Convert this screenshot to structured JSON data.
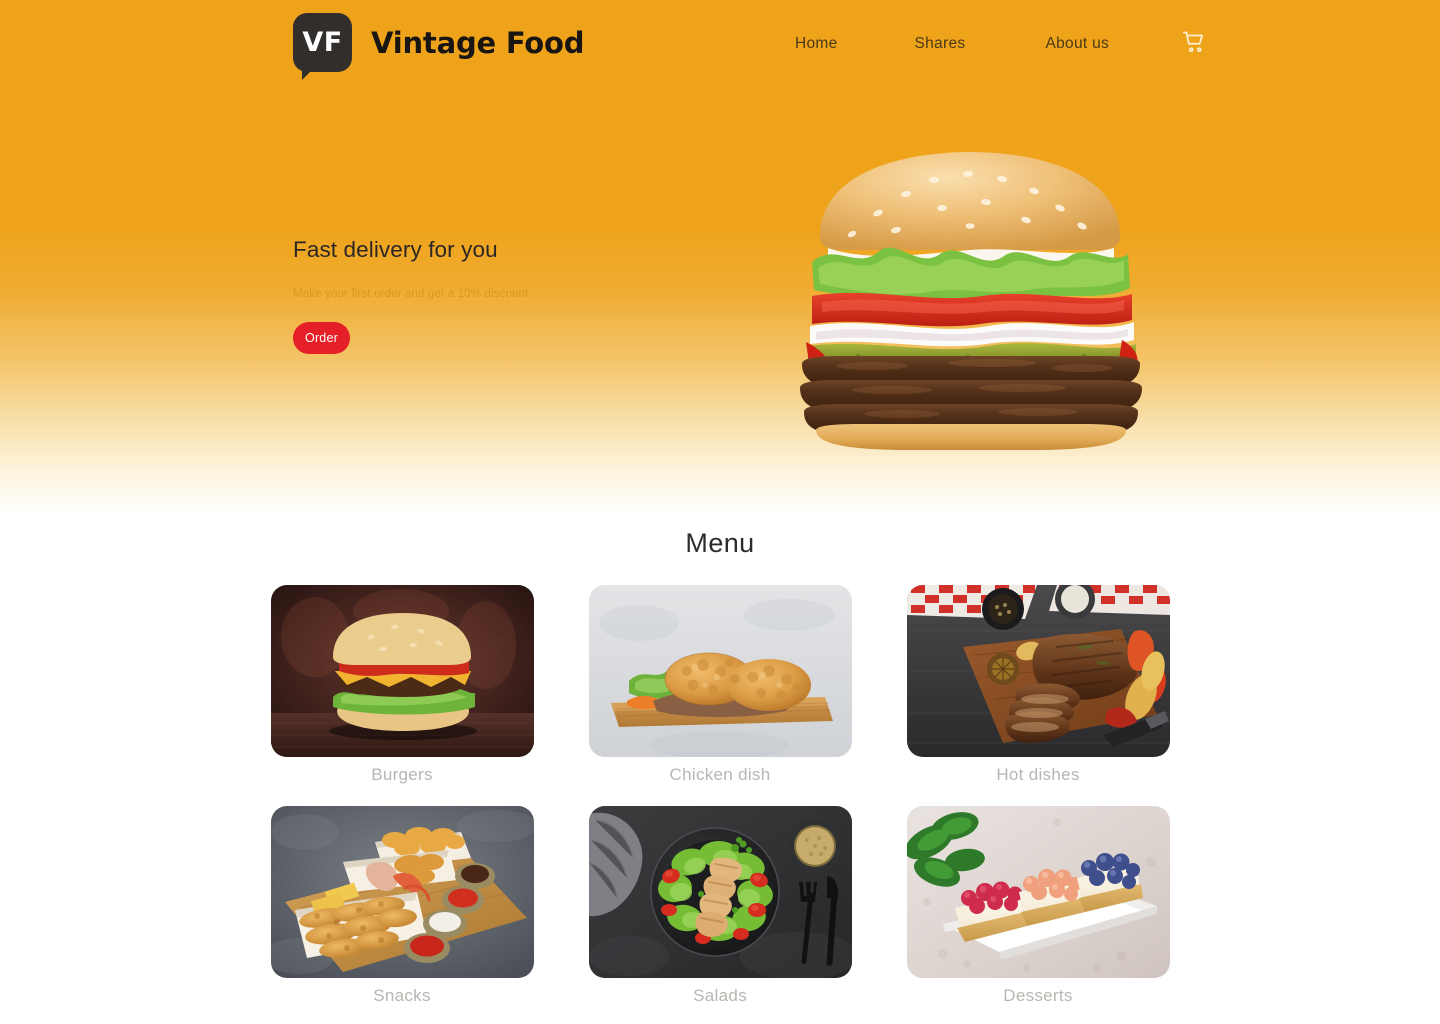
{
  "brand": {
    "monogram": "VF",
    "name": "Vintage Food",
    "logo_color": "#312e2c"
  },
  "nav": {
    "links": [
      {
        "label": "Home"
      },
      {
        "label": "Shares"
      },
      {
        "label": "About us"
      }
    ],
    "cart_icon": "shopping-cart-icon"
  },
  "hero": {
    "title": "Fast delivery for you",
    "subtitle": "Make your first order and get a 10% discount",
    "cta_label": "Order",
    "cta_color": "#e51f27",
    "background_color": "#efa31b",
    "image_alt": "triple-patty-burger"
  },
  "menu": {
    "heading": "Menu",
    "categories": [
      {
        "label": "Burgers",
        "image": "burger-card-image"
      },
      {
        "label": "Chicken dish",
        "image": "fried-chicken-card-image"
      },
      {
        "label": "Hot dishes",
        "image": "steak-card-image"
      },
      {
        "label": "Snacks",
        "image": "snacks-card-image"
      },
      {
        "label": "Salads",
        "image": "salad-card-image"
      },
      {
        "label": "Desserts",
        "image": "desserts-card-image"
      }
    ]
  }
}
